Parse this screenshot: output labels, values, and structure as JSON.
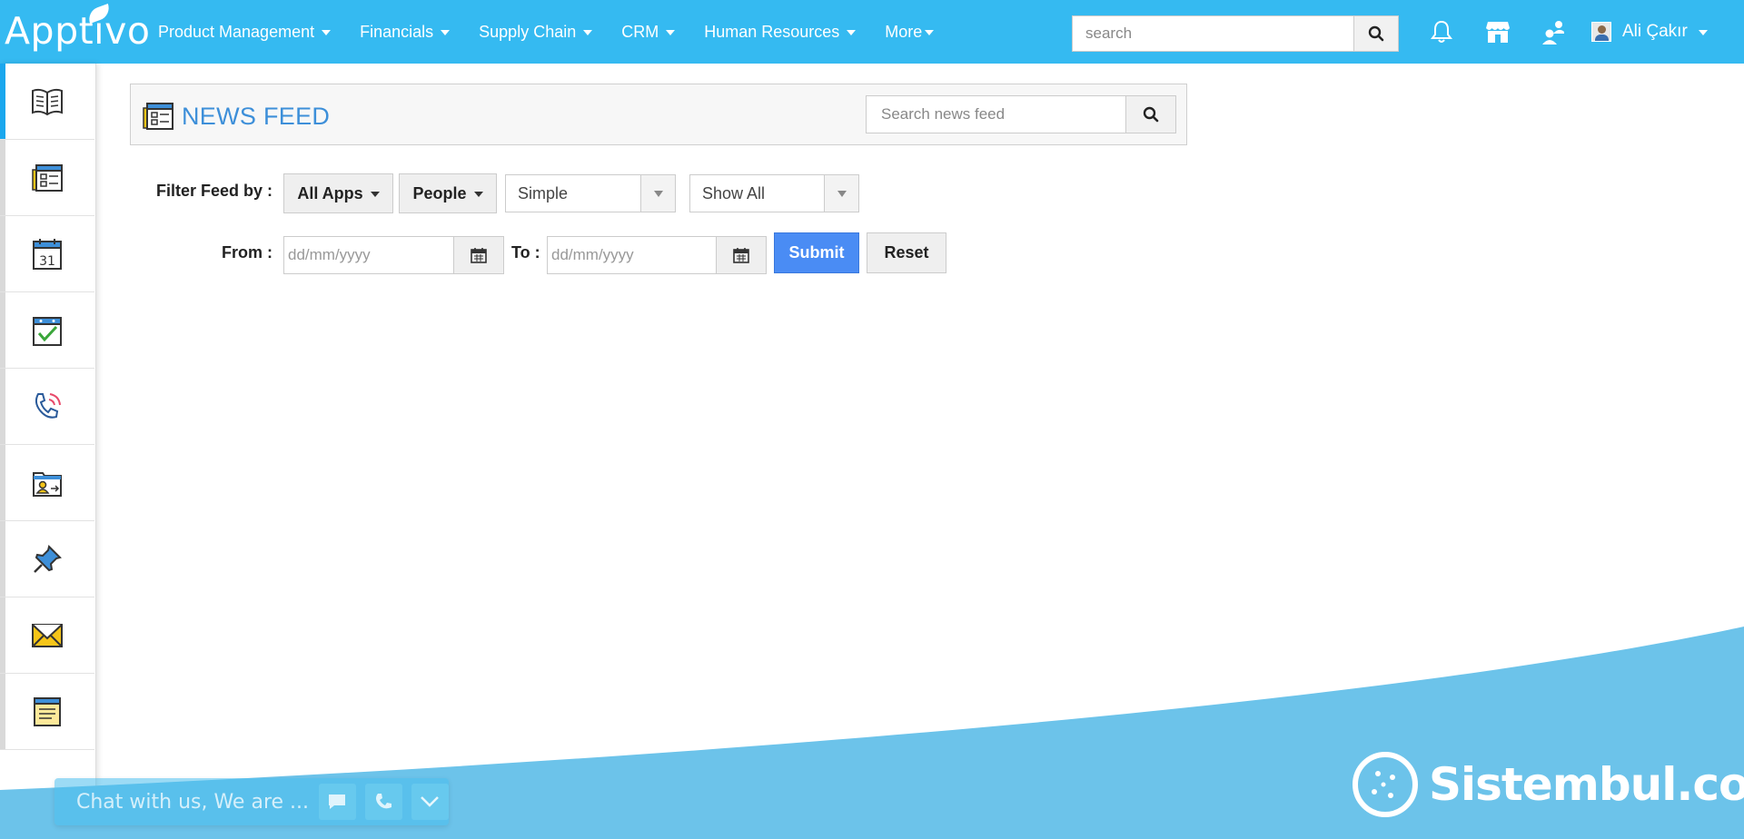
{
  "app": {
    "logo_text": "Apptivo"
  },
  "nav": {
    "items": [
      {
        "label": "Product Management"
      },
      {
        "label": "Financials"
      },
      {
        "label": "Supply Chain"
      },
      {
        "label": "CRM"
      },
      {
        "label": "Human Resources"
      },
      {
        "label": "More"
      }
    ]
  },
  "header": {
    "search_placeholder": "search",
    "user_name": "Ali Çakır",
    "icons": [
      "bell-icon",
      "store-icon",
      "people-icon"
    ]
  },
  "sidebar": {
    "items": [
      {
        "icon": "news-feed-book-icon",
        "active": true
      },
      {
        "icon": "contact-list-icon"
      },
      {
        "icon": "calendar-icon",
        "date_text": "31"
      },
      {
        "icon": "tasks-check-icon"
      },
      {
        "icon": "call-log-icon"
      },
      {
        "icon": "contact-folder-icon"
      },
      {
        "icon": "pin-icon"
      },
      {
        "icon": "email-icon"
      },
      {
        "icon": "notes-icon"
      }
    ]
  },
  "main": {
    "title": "NEWS FEED",
    "search_placeholder": "Search news feed",
    "filter_label": "Filter Feed by :",
    "apps_button": "All Apps",
    "people_button": "People",
    "view_select": "Simple",
    "show_select": "Show All",
    "from_label": "From :",
    "to_label": "To :",
    "date_placeholder": "dd/mm/yyyy",
    "submit_label": "Submit",
    "reset_label": "Reset"
  },
  "chat": {
    "text": "Chat with us, We are ..."
  },
  "watermark": {
    "text": "Sistembul.com"
  },
  "colors": {
    "topbar": "#35baf1",
    "accent": "#3d8fd9",
    "submit": "#4a8cf4",
    "wave": "#6cc3ea"
  }
}
